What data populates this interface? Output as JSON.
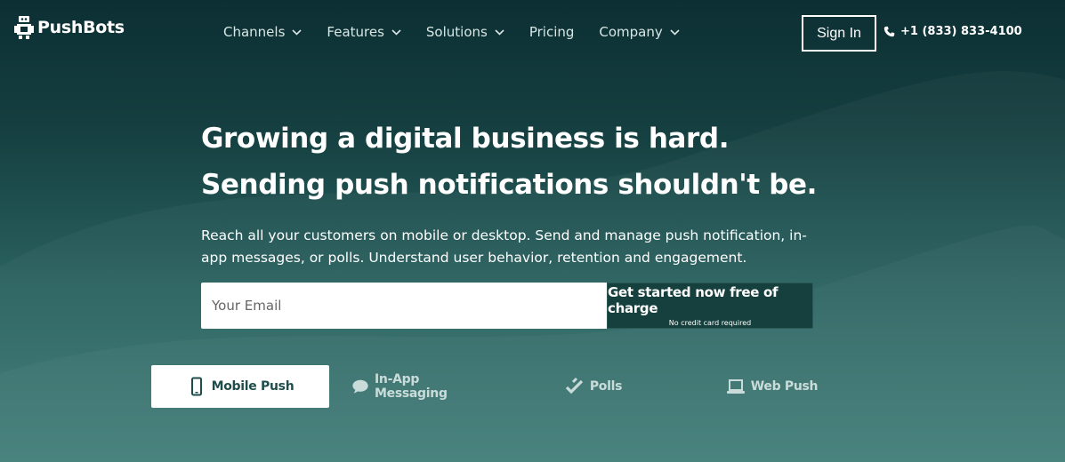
{
  "brand": {
    "name": "PushBots"
  },
  "nav": {
    "items": [
      {
        "label": "Channels",
        "dropdown": true
      },
      {
        "label": "Features",
        "dropdown": true
      },
      {
        "label": "Solutions",
        "dropdown": true
      },
      {
        "label": "Pricing",
        "dropdown": false
      },
      {
        "label": "Company",
        "dropdown": true
      }
    ],
    "signin_label": "Sign In",
    "phone": "+1 (833) 833-4100"
  },
  "hero": {
    "title": "Growing a digital business is hard. Sending push notifications shouldn't be.",
    "subtitle": "Reach all your customers on mobile or desktop. Send and manage push notification, in-app messages, or polls. Understand user behavior, retention and engagement.",
    "email_value": "",
    "email_placeholder": "Your Email",
    "cta_label": "Get started now free of charge",
    "cta_note": "No credit card required"
  },
  "tabs": [
    {
      "label": "Mobile Push",
      "icon": "mobile-phone-icon",
      "active": true
    },
    {
      "label": "In-App Messaging",
      "icon": "chat-bubble-icon",
      "active": false
    },
    {
      "label": "Polls",
      "icon": "double-check-icon",
      "active": false
    },
    {
      "label": "Web Push",
      "icon": "laptop-icon",
      "active": false
    }
  ],
  "colors": {
    "bg_top": "#0c2f33",
    "bg_bottom": "#3f7c77",
    "cta_bg": "#15403e",
    "active_tab_text": "#1f4d4c"
  }
}
